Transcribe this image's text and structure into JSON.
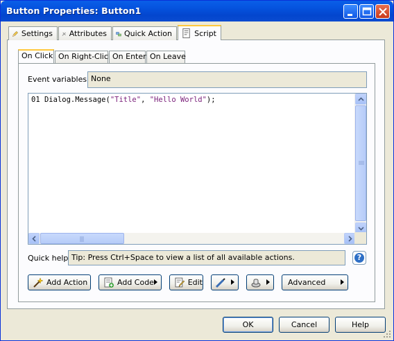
{
  "window": {
    "title": "Button Properties: Button1",
    "controls": [
      "minimize-icon",
      "maximize-icon",
      "close-icon"
    ]
  },
  "tabs": [
    {
      "label": "Settings",
      "icon": "pencil-icon"
    },
    {
      "label": "Attributes",
      "icon": "tools-icon"
    },
    {
      "label": "Quick Action",
      "icon": "quick-action-icon"
    },
    {
      "label": "Script",
      "icon": "script-icon",
      "active": true
    }
  ],
  "subtabs": [
    {
      "label": "On Click",
      "active": true
    },
    {
      "label": "On Right-Click"
    },
    {
      "label": "On Enter"
    },
    {
      "label": "On Leave"
    }
  ],
  "event_variables": {
    "label": "Event variables:",
    "value": "None"
  },
  "editor": {
    "line_number": "01",
    "code_prefix": "Dialog.Message(",
    "string1": "\"Title\"",
    "sep": ", ",
    "string2": "\"Hello World\"",
    "code_suffix": ");"
  },
  "quick_help": {
    "label": "Quick help:",
    "text": "Tip: Press Ctrl+Space to view a list of all available actions."
  },
  "toolbar": {
    "add_action": "Add Action",
    "add_code": "Add Code",
    "edit": "Edit",
    "advanced": "Advanced"
  },
  "footer": {
    "ok": "OK",
    "cancel": "Cancel",
    "help": "Help"
  },
  "colors": {
    "titlebar": "#0553DE",
    "active_tab_accent": "#FFC83C",
    "string_literal": "#7A1F7A"
  }
}
